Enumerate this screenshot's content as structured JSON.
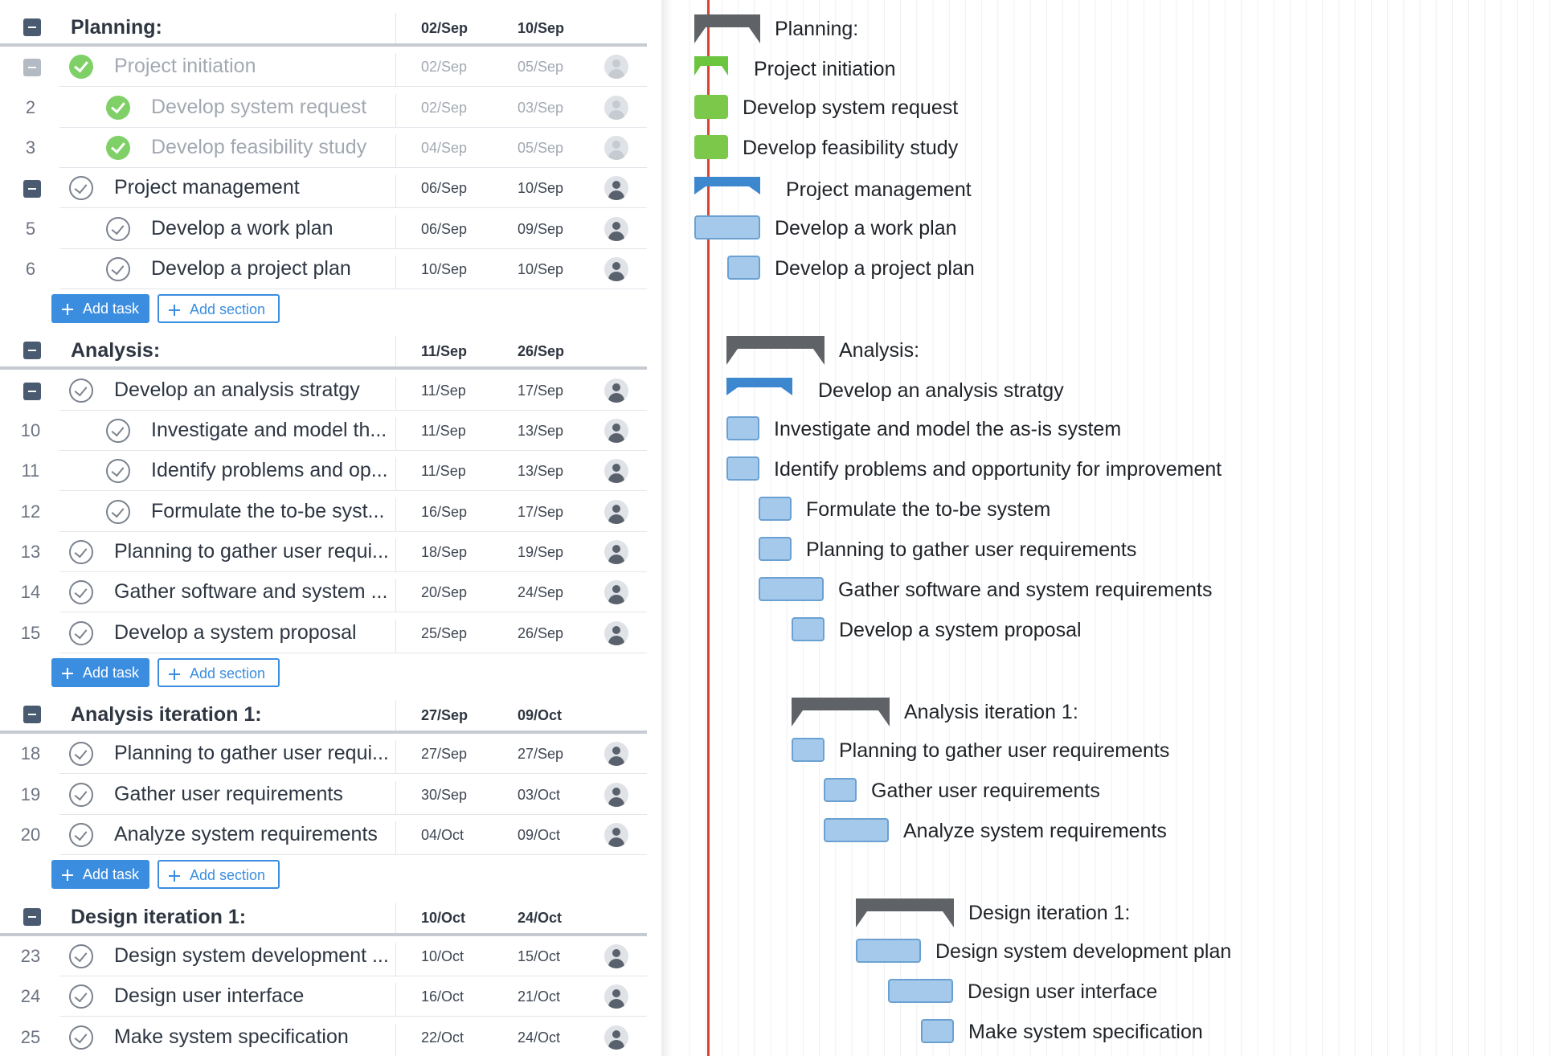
{
  "colors": {
    "accent": "#3b8de0",
    "done_check": "#7fd067",
    "today_line": "#d9432f",
    "task_bar": "#a5c9ea",
    "done_bar": "#7cc84a",
    "section_bar": "#5f6368",
    "parent_bar": "#3d87cf"
  },
  "buttons": {
    "add_task": "Add task",
    "add_section": "Add section"
  },
  "grid": {
    "sections": [
      {
        "name": "Planning:",
        "start": "02/Sep",
        "end": "10/Sep",
        "tasks": [
          {
            "num": "",
            "name": "Project initiation",
            "start": "02/Sep",
            "end": "05/Sep",
            "level": 1,
            "status": "done",
            "collapsible": true
          },
          {
            "num": "2",
            "name": "Develop system request",
            "start": "02/Sep",
            "end": "03/Sep",
            "level": 2,
            "status": "done"
          },
          {
            "num": "3",
            "name": "Develop feasibility study",
            "start": "04/Sep",
            "end": "05/Sep",
            "level": 2,
            "status": "done"
          },
          {
            "num": "",
            "name": "Project management",
            "start": "06/Sep",
            "end": "10/Sep",
            "level": 1,
            "status": "open",
            "collapsible": true
          },
          {
            "num": "5",
            "name": "Develop a work plan",
            "start": "06/Sep",
            "end": "09/Sep",
            "level": 2,
            "status": "open"
          },
          {
            "num": "6",
            "name": "Develop a project plan",
            "start": "10/Sep",
            "end": "10/Sep",
            "level": 2,
            "status": "open"
          }
        ]
      },
      {
        "name": "Analysis:",
        "start": "11/Sep",
        "end": "26/Sep",
        "tasks": [
          {
            "num": "",
            "name": "Develop an analysis stratgy",
            "start": "11/Sep",
            "end": "17/Sep",
            "level": 1,
            "status": "open",
            "collapsible": true
          },
          {
            "num": "10",
            "name": "Investigate and model th...",
            "start": "11/Sep",
            "end": "13/Sep",
            "level": 2,
            "status": "open"
          },
          {
            "num": "11",
            "name": "Identify problems and op...",
            "start": "11/Sep",
            "end": "13/Sep",
            "level": 2,
            "status": "open"
          },
          {
            "num": "12",
            "name": "Formulate the to-be syst...",
            "start": "16/Sep",
            "end": "17/Sep",
            "level": 2,
            "status": "open"
          },
          {
            "num": "13",
            "name": "Planning to gather user requi...",
            "start": "18/Sep",
            "end": "19/Sep",
            "level": 1,
            "status": "open"
          },
          {
            "num": "14",
            "name": "Gather software and system ...",
            "start": "20/Sep",
            "end": "24/Sep",
            "level": 1,
            "status": "open"
          },
          {
            "num": "15",
            "name": "Develop a system proposal",
            "start": "25/Sep",
            "end": "26/Sep",
            "level": 1,
            "status": "open"
          }
        ]
      },
      {
        "name": "Analysis iteration 1:",
        "start": "27/Sep",
        "end": "09/Oct",
        "tasks": [
          {
            "num": "18",
            "name": "Planning to gather user requi...",
            "start": "27/Sep",
            "end": "27/Sep",
            "level": 1,
            "status": "open"
          },
          {
            "num": "19",
            "name": "Gather user requirements",
            "start": "30/Sep",
            "end": "03/Oct",
            "level": 1,
            "status": "open"
          },
          {
            "num": "20",
            "name": "Analyze system requirements",
            "start": "04/Oct",
            "end": "09/Oct",
            "level": 1,
            "status": "open"
          }
        ]
      },
      {
        "name": "Design iteration 1:",
        "start": "10/Oct",
        "end": "24/Oct",
        "tasks": [
          {
            "num": "23",
            "name": "Design system development ...",
            "start": "10/Oct",
            "end": "15/Oct",
            "level": 1,
            "status": "open"
          },
          {
            "num": "24",
            "name": "Design user interface",
            "start": "16/Oct",
            "end": "21/Oct",
            "level": 1,
            "status": "open"
          },
          {
            "num": "25",
            "name": "Make system specification",
            "start": "22/Oct",
            "end": "24/Oct",
            "level": 1,
            "status": "open"
          }
        ]
      }
    ]
  },
  "gantt": {
    "items": [
      {
        "label": "Planning:",
        "type": "section"
      },
      {
        "label": "Project initiation",
        "type": "parent-done"
      },
      {
        "label": "Develop system request",
        "type": "task-done"
      },
      {
        "label": "Develop feasibility study",
        "type": "task-done"
      },
      {
        "label": "Project management",
        "type": "parent"
      },
      {
        "label": "Develop a work plan",
        "type": "task"
      },
      {
        "label": "Develop a project plan",
        "type": "task"
      },
      {
        "label": "Analysis:",
        "type": "section"
      },
      {
        "label": "Develop an analysis stratgy",
        "type": "parent"
      },
      {
        "label": "Investigate and model the as-is system",
        "type": "task"
      },
      {
        "label": "Identify problems and opportunity for improvement",
        "type": "task"
      },
      {
        "label": "Formulate the to-be system",
        "type": "task"
      },
      {
        "label": "Planning to gather user requirements",
        "type": "task"
      },
      {
        "label": "Gather software and system requirements",
        "type": "task"
      },
      {
        "label": "Develop a system proposal",
        "type": "task"
      },
      {
        "label": "Analysis iteration 1:",
        "type": "section"
      },
      {
        "label": "Planning to gather user requirements",
        "type": "task"
      },
      {
        "label": "Gather user requirements",
        "type": "task"
      },
      {
        "label": "Analyze system requirements",
        "type": "task"
      },
      {
        "label": "Design iteration 1:",
        "type": "section"
      },
      {
        "label": "Design system development plan",
        "type": "task"
      },
      {
        "label": "Design user interface",
        "type": "task"
      },
      {
        "label": "Make system specification",
        "type": "task"
      }
    ]
  }
}
